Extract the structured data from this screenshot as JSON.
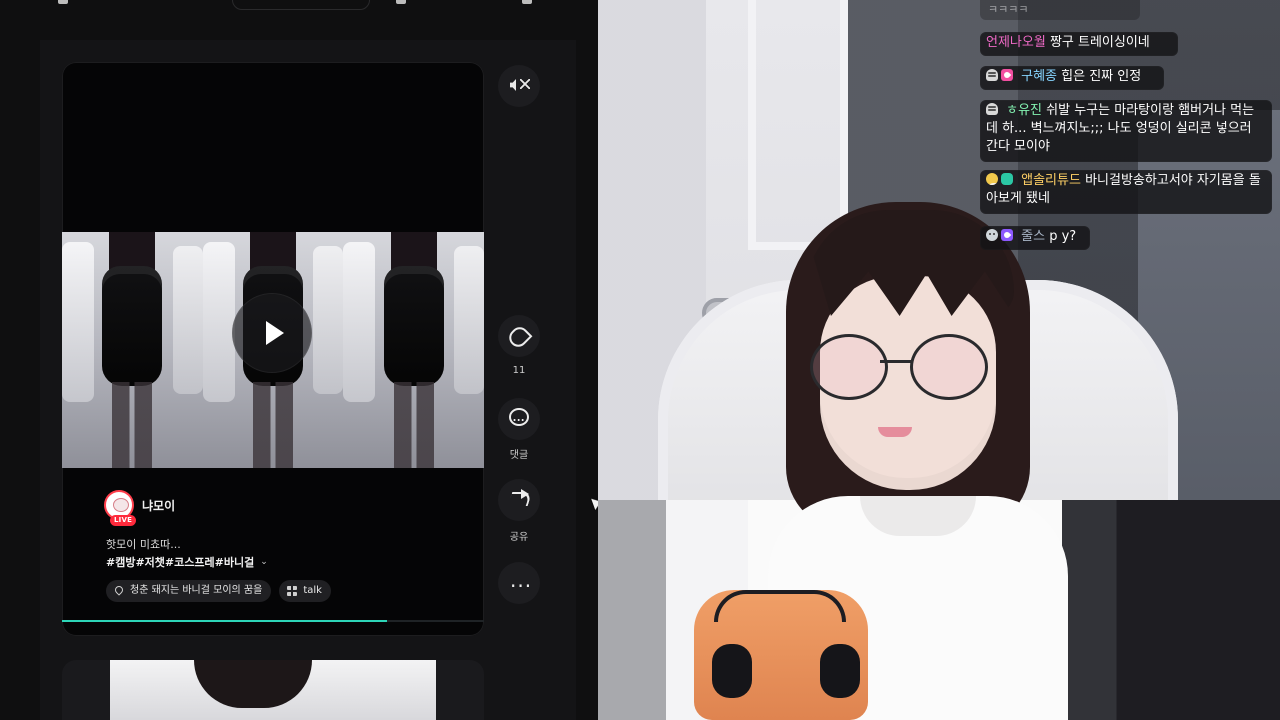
{
  "left_panel": {
    "actions": {
      "like_count": "11",
      "comment_label": "댓글",
      "share_label": "공유"
    },
    "post": {
      "channel_name": "냐모이",
      "live_badge": "LIVE",
      "caption": "핫모이 미쵸따...",
      "hashtags": "#캠방#저챗#코스프레#바니걸",
      "chip_location": "청춘 돼지는 바니걸 모이의 꿈을",
      "chip_talk": "talk",
      "progress_percent": 77
    }
  },
  "chat": {
    "top_partial": "ㅋㅋㅋㅋ",
    "messages": [
      {
        "user": "언제나오월",
        "text": "짱구 트레이싱이네"
      },
      {
        "user": "구혜종",
        "text": "힙은 진짜 인정"
      },
      {
        "user": "ㅎ유진",
        "text": "쉬발 누구는 마라탕이랑 햄버거나 먹는데 하... 벽느껴지노;;; 나도 엉덩이 실리콘 넣으러 간다 모이야"
      },
      {
        "user": "앱솔리튜드",
        "text": "바니걸방송하고서야 자기몸을 돌아보게 됐네"
      },
      {
        "user": "줄스",
        "text": "p y?"
      }
    ]
  },
  "icons": {
    "mute": "mute-icon",
    "heart": "heart-icon",
    "comment": "comment-icon",
    "share": "share-icon",
    "more": "more-icon",
    "play": "play-icon",
    "location_chip": "location-icon",
    "talk_chip": "talk-icon"
  },
  "colors": {
    "progress_fill": "#2dd5b7",
    "live_red": "#ff2a3c",
    "chat_pink": "#f06ac7",
    "chat_cyan": "#87d5ff",
    "chat_green": "#83f2b1",
    "chat_gold": "#ffd166",
    "chat_gray": "#aab7c8"
  }
}
